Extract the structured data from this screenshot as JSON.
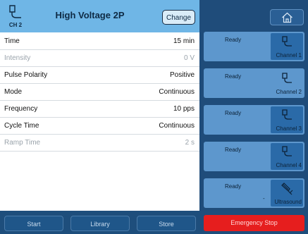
{
  "header": {
    "channel_label": "CH 2",
    "title": "High Voltage 2P",
    "change_label": "Change"
  },
  "params": [
    {
      "label": "Time",
      "value": "15 min",
      "dimmed": false
    },
    {
      "label": "Intensity",
      "value": "0 V",
      "dimmed": true
    },
    {
      "label": "Pulse Polarity",
      "value": "Positive",
      "dimmed": false
    },
    {
      "label": "Mode",
      "value": "Continuous",
      "dimmed": false
    },
    {
      "label": "Frequency",
      "value": "10 pps",
      "dimmed": false
    },
    {
      "label": "Cycle Time",
      "value": "Continuous",
      "dimmed": false
    },
    {
      "label": "Ramp Time",
      "value": "2 s",
      "dimmed": true
    }
  ],
  "bottom_left": {
    "start_label": "Start",
    "library_label": "Library",
    "store_label": "Store"
  },
  "channels": [
    {
      "status": "Ready",
      "name": "Channel 1",
      "icon": "electrode-icon"
    },
    {
      "status": "Ready",
      "name": "Channel 2",
      "icon": "electrode-icon"
    },
    {
      "status": "Ready",
      "name": "Channel 3",
      "icon": "electrode-icon"
    },
    {
      "status": "Ready",
      "name": "Channel 4",
      "icon": "electrode-icon"
    },
    {
      "status": "Ready",
      "name": "Ultrasound",
      "icon": "ultrasound-icon",
      "extra": "-"
    }
  ],
  "emergency_label": "Emergency Stop",
  "colors": {
    "header_bg": "#6fb6e6",
    "panel_bg": "#1f4c7a",
    "channel_bg": "#5d97cd",
    "emergency": "#e61e1e"
  }
}
